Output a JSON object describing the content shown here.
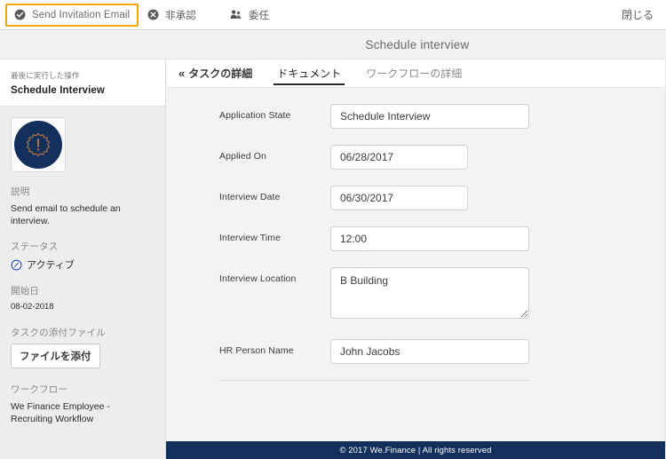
{
  "toolbar": {
    "actions": [
      {
        "id": "send-invitation-email",
        "label": "Send Invitation Email",
        "icon": "check-circle-icon",
        "focused": true
      },
      {
        "id": "reject",
        "label": "非承認",
        "icon": "x-circle-icon",
        "focused": false
      },
      {
        "id": "delegate",
        "label": "委任",
        "icon": "users-icon",
        "focused": false
      }
    ],
    "close_label": "閉じる",
    "focus_border_color": "#f0a30a"
  },
  "header": {
    "title": "Schedule interview"
  },
  "sidebar": {
    "last_action_label": "最後に実行した操作",
    "last_action_value": "Schedule Interview",
    "avatar_icon": "alert-badge-icon",
    "avatar_bg_color": "#12305b",
    "avatar_icon_color": "#c8803c",
    "description_label": "説明",
    "description_value": "Send email to schedule an interview.",
    "status_label": "ステータス",
    "status_value": "アクティブ",
    "status_icon": "clock-circle-icon",
    "status_icon_color": "#2b50c8",
    "start_date_label": "開始日",
    "start_date_value": "08-02-2018",
    "attachments_label": "タスクの添付ファイル",
    "attach_button_label": "ファイルを添付",
    "workflow_label": "ワークフロー",
    "workflow_value": "We Finance Employee - Recruiting Workflow"
  },
  "tabs": [
    {
      "id": "task-details",
      "label": "タスクの詳細",
      "chevron": "«",
      "active": false,
      "back": true
    },
    {
      "id": "documents",
      "label": "ドキュメント",
      "active": true,
      "back": false
    },
    {
      "id": "workflow-details",
      "label": "ワークフローの詳細",
      "active": false,
      "back": false
    }
  ],
  "form": {
    "fields": [
      {
        "id": "application-state",
        "label": "Application State",
        "value": "Schedule Interview",
        "type": "text",
        "width": "wide"
      },
      {
        "id": "applied-on",
        "label": "Applied On",
        "value": "06/28/2017",
        "type": "text",
        "width": "narrow"
      },
      {
        "id": "interview-date",
        "label": "Interview Date",
        "value": "06/30/2017",
        "type": "text",
        "width": "narrow"
      },
      {
        "id": "interview-time",
        "label": "Interview Time",
        "value": "12:00",
        "type": "text",
        "width": "wide"
      },
      {
        "id": "interview-location",
        "label": "Interview Location",
        "value": "B Building",
        "type": "textarea",
        "width": "wide"
      },
      {
        "id": "hr-person-name",
        "label": "HR Person Name",
        "value": "John Jacobs",
        "type": "text",
        "width": "wide"
      }
    ]
  },
  "footer": {
    "text": "© 2017 We.Finance | All rights reserved",
    "bg_color": "#12305b"
  }
}
